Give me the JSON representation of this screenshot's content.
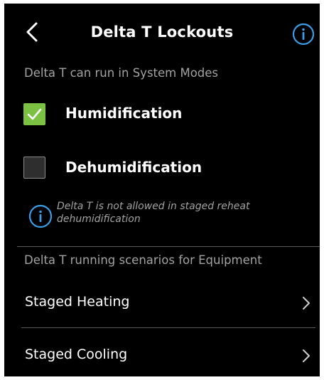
{
  "header": {
    "title": "Delta T Lockouts",
    "back_icon": "chevron-left-icon",
    "info_icon": "info-icon"
  },
  "system_modes": {
    "section_label": "Delta T can run in System Modes",
    "options": [
      {
        "label": "Humidification",
        "checked": true
      },
      {
        "label": "Dehumidification",
        "checked": false
      }
    ],
    "note": "Delta T is not allowed in staged reheat dehumidification"
  },
  "equipment": {
    "section_label": "Delta T running scenarios for Equipment",
    "items": [
      {
        "label": "Staged Heating"
      },
      {
        "label": "Staged Cooling"
      }
    ]
  },
  "colors": {
    "background": "#000000",
    "accent_blue": "#3a9ee6",
    "check_green": "#7bc242",
    "secondary_text": "#a3a3a3"
  }
}
